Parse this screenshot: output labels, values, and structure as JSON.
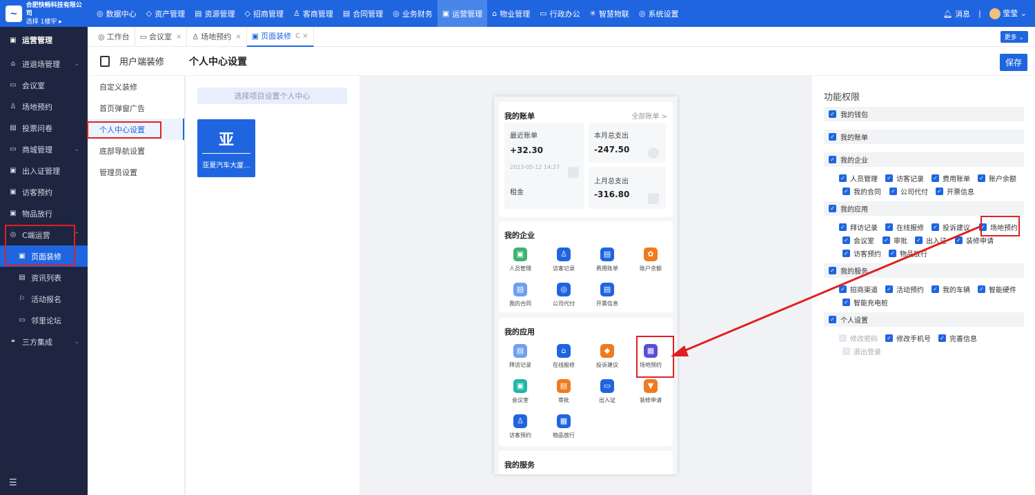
{
  "brand": {
    "name": "合肥快畅科技有限公司",
    "sub": "选择 1楼宇 ▸"
  },
  "topnav": [
    {
      "label": "数据中心",
      "icon": "◎"
    },
    {
      "label": "资产管理",
      "icon": "◇"
    },
    {
      "label": "资源管理",
      "icon": "▤"
    },
    {
      "label": "招商管理",
      "icon": "◇"
    },
    {
      "label": "客商管理",
      "icon": "♙"
    },
    {
      "label": "合同管理",
      "icon": "▤"
    },
    {
      "label": "业务财务",
      "icon": "◎"
    },
    {
      "label": "运营管理",
      "icon": "▣"
    },
    {
      "label": "物业管理",
      "icon": "⌂"
    },
    {
      "label": "行政办公",
      "icon": "▭"
    },
    {
      "label": "智慧物联",
      "icon": "✳"
    },
    {
      "label": "系统设置",
      "icon": "◎"
    }
  ],
  "top_right": {
    "message": "消息",
    "user": "莹莹"
  },
  "sidebar": {
    "header": "运营管理",
    "items": [
      {
        "label": "进退场管理",
        "icon": "⌂",
        "chev": "⌄"
      },
      {
        "label": "会议室",
        "icon": "▭"
      },
      {
        "label": "场地预约",
        "icon": "♙"
      },
      {
        "label": "投票问卷",
        "icon": "▤"
      },
      {
        "label": "商城管理",
        "icon": "▭",
        "chev": "⌄"
      },
      {
        "label": "出入证管理",
        "icon": "▣"
      },
      {
        "label": "访客预约",
        "icon": "▣"
      },
      {
        "label": "物品放行",
        "icon": "▣"
      },
      {
        "label": "C端运营",
        "icon": "◎",
        "chev": "⌃"
      }
    ],
    "sub_items": [
      {
        "label": "页面装修",
        "icon": "▣"
      },
      {
        "label": "资讯列表",
        "icon": "▤"
      },
      {
        "label": "活动报名",
        "icon": "⚐"
      },
      {
        "label": "邻里论坛",
        "icon": "▭"
      }
    ],
    "last": {
      "label": "三方集成",
      "icon": "⚭",
      "chev": "⌄"
    },
    "collapse_icon": "☰"
  },
  "tabs": [
    {
      "label": "工作台",
      "icon": "◎"
    },
    {
      "label": "会议室",
      "icon": "▭",
      "close": "×"
    },
    {
      "label": "场地预约",
      "icon": "♙",
      "close": "×"
    },
    {
      "label": "页面装修",
      "icon": "▣",
      "close": "C ×"
    }
  ],
  "more": "更多 ⌄",
  "header": {
    "left": "用户端装修",
    "title": "个人中心设置",
    "save": "保存"
  },
  "left_menu": [
    "自定义装修",
    "首页弹窗广告",
    "个人中心设置",
    "底部导航设置",
    "管理员设置"
  ],
  "project": {
    "placeholder": "选择项目设置个人中心",
    "char": "亚",
    "name": "亚夏汽车大厦..."
  },
  "preview": {
    "bill": {
      "title": "我的账单",
      "link": "全部账单 >",
      "recent_label": "最近账单",
      "recent_amount": "+32.30",
      "recent_date": "2023-05-12 14:27",
      "rent": "租金",
      "month_label": "本月总支出",
      "month_amount": "-247.50",
      "last_label": "上月总支出",
      "last_amount": "-316.80"
    },
    "enterprise": {
      "title": "我的企业",
      "items": [
        {
          "label": "人员管理",
          "color": "#3cb371",
          "icon": "▣"
        },
        {
          "label": "访客记录",
          "color": "#1f65e0",
          "icon": "♙"
        },
        {
          "label": "费用账单",
          "color": "#1f65e0",
          "icon": "▤"
        },
        {
          "label": "账户余额",
          "color": "#f07a1f",
          "icon": "✿"
        },
        {
          "label": "我的合同",
          "color": "#6fa0f0",
          "icon": "▤"
        },
        {
          "label": "公司代付",
          "color": "#1f65e0",
          "icon": "◎"
        },
        {
          "label": "开票信息",
          "color": "#1f65e0",
          "icon": "▤"
        }
      ]
    },
    "apps": {
      "title": "我的应用",
      "items": [
        {
          "label": "拜访记录",
          "color": "#6fa0f0",
          "icon": "▤"
        },
        {
          "label": "在线报修",
          "color": "#1f65e0",
          "icon": "⌂"
        },
        {
          "label": "投诉建议",
          "color": "#f07a1f",
          "icon": "◆"
        },
        {
          "label": "场地预约",
          "color": "#5a4ed8",
          "icon": "▦"
        },
        {
          "label": "会议室",
          "color": "#1fb8a8",
          "icon": "▣"
        },
        {
          "label": "审批",
          "color": "#f07a1f",
          "icon": "▤"
        },
        {
          "label": "出入证",
          "color": "#1f65e0",
          "icon": "▭"
        },
        {
          "label": "装修申请",
          "color": "#f07a1f",
          "icon": "▼"
        },
        {
          "label": "访客预约",
          "color": "#1f65e0",
          "icon": "♙"
        },
        {
          "label": "物品放行",
          "color": "#1f65e0",
          "icon": "▦"
        }
      ]
    },
    "services": {
      "title": "我的服务"
    }
  },
  "permissions": {
    "title": "功能权限",
    "groups": [
      {
        "label": "我的钱包"
      },
      {
        "label": "我的账单"
      },
      {
        "label": "我的企业",
        "options": [
          "人员管理",
          "访客记录",
          "费用账单",
          "账户余额",
          "我的合同",
          "公司代付",
          "开票信息"
        ]
      },
      {
        "label": "我的应用",
        "options": [
          "拜访记录",
          "在线报修",
          "投诉建议",
          "场地预约",
          "会议室",
          "审批",
          "出入证",
          "装修申请",
          "访客预约",
          "物品放行"
        ]
      },
      {
        "label": "我的服务",
        "options": [
          "招商渠道",
          "活动预约",
          "我的车辆",
          "智能硬件",
          "智能充电桩"
        ]
      },
      {
        "label": "个人设置",
        "options": [
          "修改密码",
          "修改手机号",
          "完善信息",
          "退出登录"
        ]
      }
    ]
  },
  "colors": {
    "primary": "#1f65e0",
    "sidebar_bg": "#1e2540",
    "highlight": "#e02020"
  }
}
